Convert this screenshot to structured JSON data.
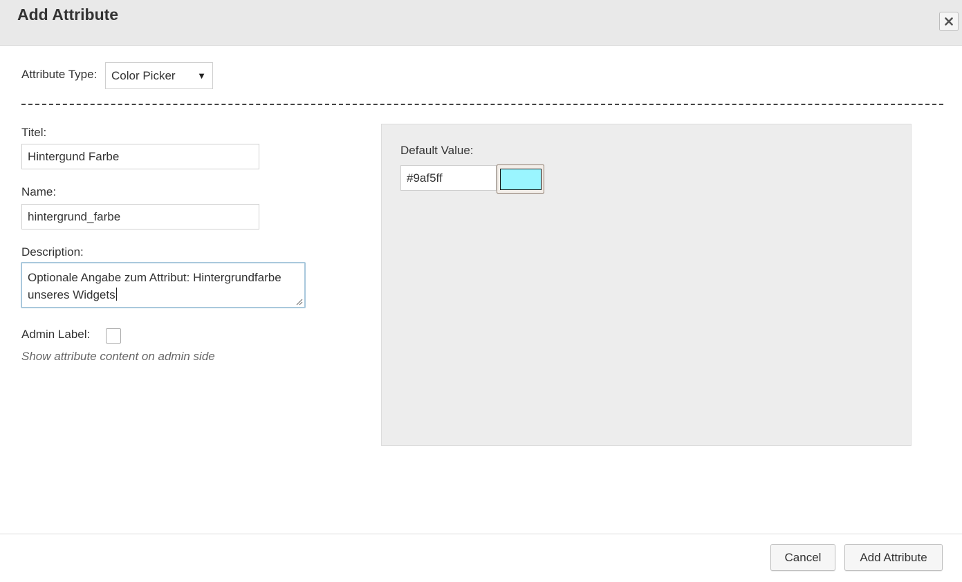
{
  "header": {
    "title": "Add Attribute",
    "close_icon": "close-icon"
  },
  "attribute_type": {
    "label": "Attribute Type:",
    "selected": "Color Picker"
  },
  "form": {
    "titel_label": "Titel:",
    "titel_value": "Hintergund Farbe",
    "name_label": "Name:",
    "name_value": "hintergrund_farbe",
    "description_label": "Description:",
    "description_value": "Optionale Angabe zum Attribut: Hintergrundfarbe unseres Widgets",
    "admin_label": "Admin Label:",
    "admin_checked": false,
    "admin_hint": "Show attribute content on admin side"
  },
  "default_value": {
    "label": "Default Value:",
    "value": "#9af5ff",
    "swatch_color": "#9af5ff"
  },
  "footer": {
    "cancel_label": "Cancel",
    "add_label": "Add Attribute"
  }
}
